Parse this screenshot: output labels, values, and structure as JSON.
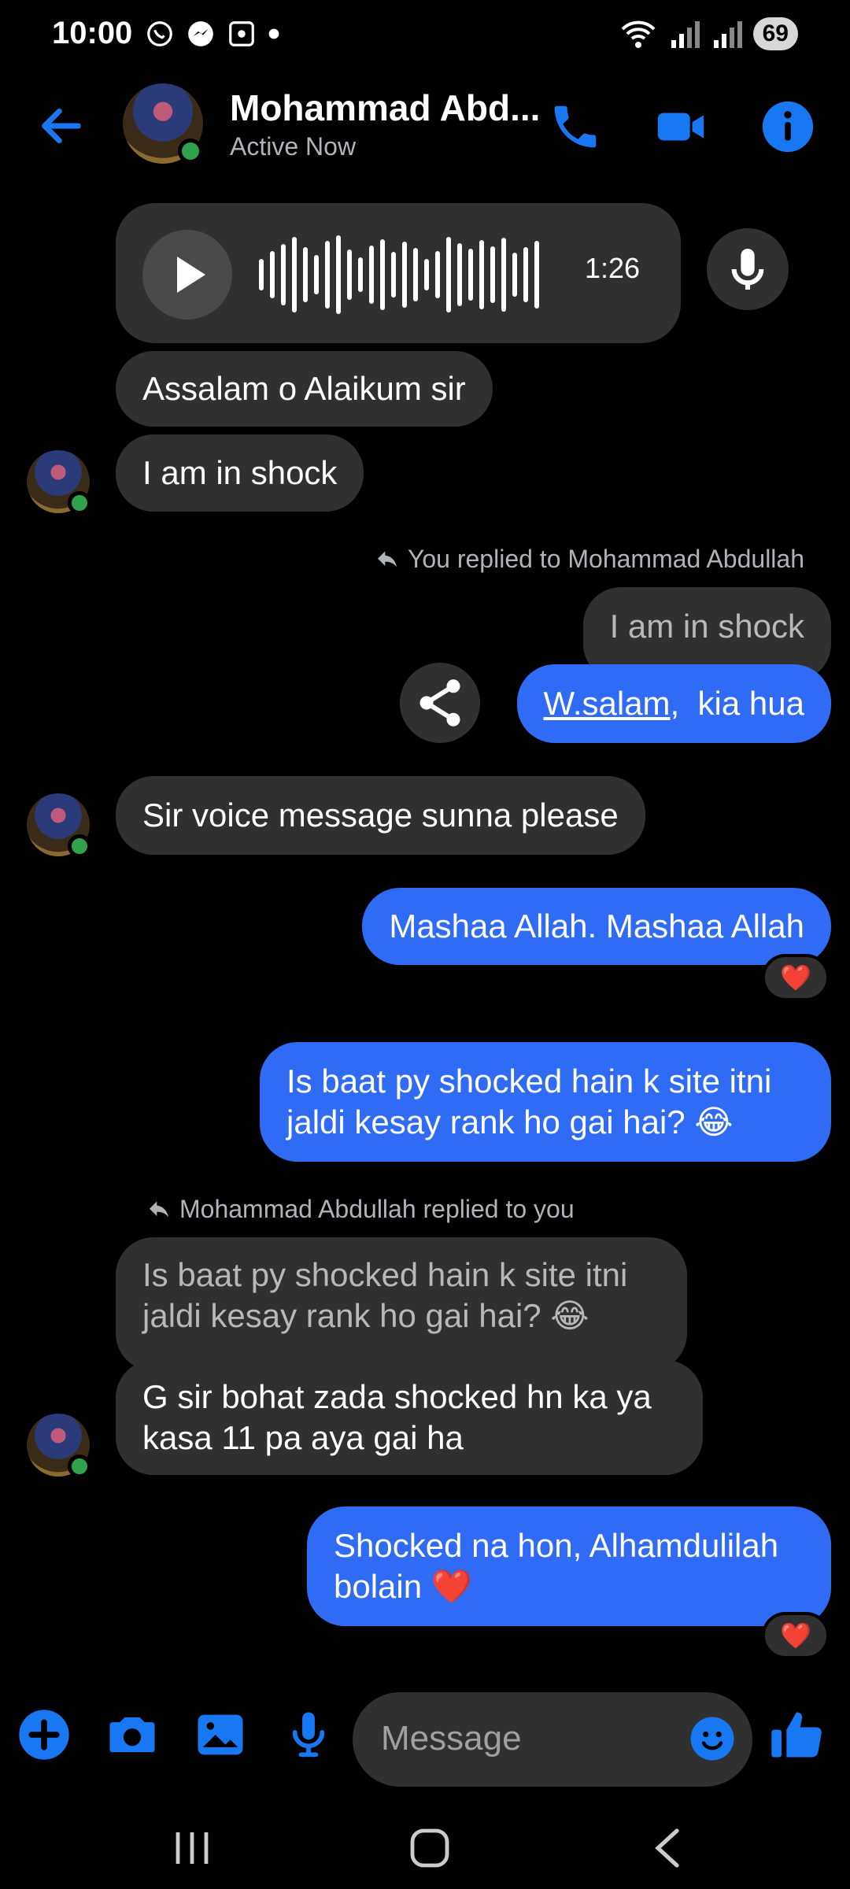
{
  "status_bar": {
    "time": "10:00",
    "battery": "69"
  },
  "header": {
    "contact_name": "Mohammad Abd...",
    "status": "Active Now"
  },
  "voice_message": {
    "duration": "1:26"
  },
  "messages": [
    {
      "text": "Assalam o Alaikum sir"
    },
    {
      "text": "I am in shock"
    },
    {
      "reply_note": "You replied to Mohammad Abdullah",
      "quoted": "I am in shock",
      "link": "W.salam",
      "text": ",  kia hua"
    },
    {
      "text": "Sir voice message sunna please"
    },
    {
      "text": "Mashaa Allah. Mashaa Allah",
      "reaction": "❤️"
    },
    {
      "text": "Is baat py shocked hain k site itni jaldi kesay rank ho gai hai? 😂"
    },
    {
      "reply_note": "Mohammad Abdullah replied to you",
      "quoted": "Is baat py shocked hain k site itni jaldi kesay rank ho gai hai? 😂",
      "text": "G sir bohat zada shocked hn ka ya kasa 11 pa aya gai ha"
    },
    {
      "text": "Shocked na hon, Alhamdulilah bolain ❤️",
      "reaction": "❤️"
    }
  ],
  "composer": {
    "placeholder": "Message"
  },
  "colors": {
    "accent": "#1877f2",
    "bubble_out": "#2f6bf5",
    "bubble_in": "#303030",
    "online": "#31a24c"
  },
  "icons": [
    "back-arrow-icon",
    "phone-icon",
    "video-icon",
    "info-icon",
    "play-icon",
    "mic-icon",
    "share-icon",
    "reply-arrow-icon",
    "plus-icon",
    "camera-icon",
    "gallery-icon",
    "emoji-icon",
    "like-icon"
  ]
}
